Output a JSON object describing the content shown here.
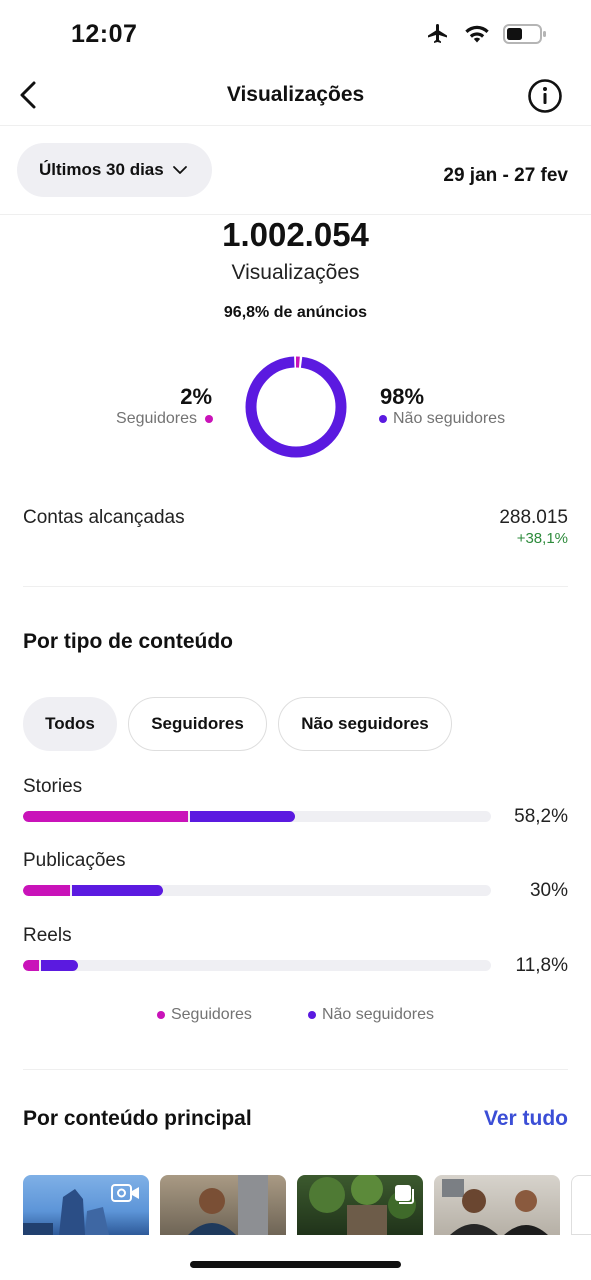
{
  "status_bar": {
    "time": "12:07"
  },
  "nav": {
    "title": "Visualizações"
  },
  "filter": {
    "period": "Últimos 30 dias",
    "date_range": "29 jan - 27 fev"
  },
  "summary": {
    "total": "1.002.054",
    "total_label": "Visualizações",
    "ads_note": "96,8% de anúncios",
    "followers_pct": "2%",
    "followers_label": "Seguidores",
    "non_followers_pct": "98%",
    "non_followers_label": "Não seguidores",
    "followers_share": 0.02
  },
  "reach": {
    "label": "Contas alcançadas",
    "value": "288.015",
    "change": "+38,1%"
  },
  "content_type": {
    "title": "Por tipo de conteúdo",
    "chips": [
      "Todos",
      "Seguidores",
      "Não seguidores"
    ],
    "rows": [
      {
        "name": "Stories",
        "pct_text": "58,2%",
        "followers": 0.352,
        "non_followers": 0.23
      },
      {
        "name": "Publicações",
        "pct_text": "30%",
        "followers": 0.1,
        "non_followers": 0.2
      },
      {
        "name": "Reels",
        "pct_text": "11,8%",
        "followers": 0.035,
        "non_followers": 0.083
      }
    ],
    "legend": {
      "followers": "Seguidores",
      "non_followers": "Não seguidores"
    }
  },
  "top_content": {
    "title": "Por conteúdo principal",
    "see_all": "Ver tudo"
  },
  "colors": {
    "followers": "#c913b9",
    "non_followers": "#5b1ae0",
    "positive": "#2e8b3c",
    "link": "#3b4ed6"
  }
}
